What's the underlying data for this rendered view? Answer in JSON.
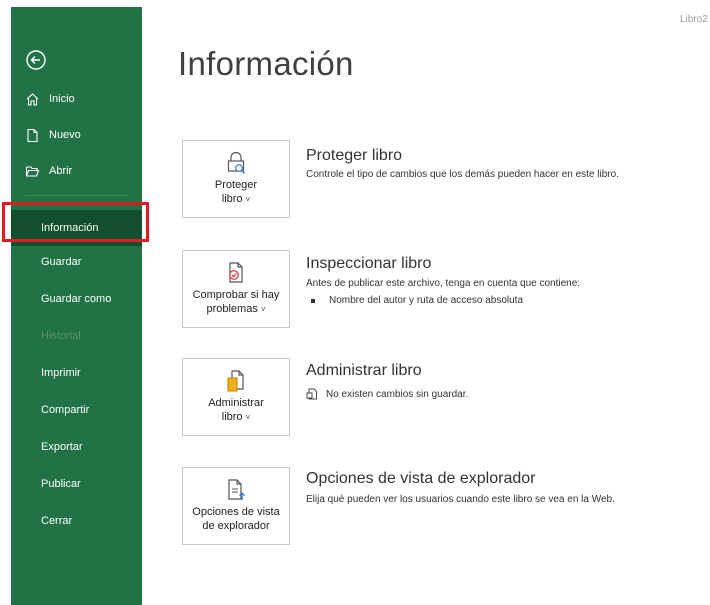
{
  "window": {
    "doc_name": "Libro2"
  },
  "sidebar": {
    "back_icon": "back-arrow-icon",
    "top_items": [
      {
        "label": "Inicio",
        "icon": "home-icon"
      },
      {
        "label": "Nuevo",
        "icon": "new-file-icon"
      },
      {
        "label": "Abrir",
        "icon": "open-folder-icon"
      }
    ],
    "sub_items": [
      {
        "label": "Información",
        "state": "active"
      },
      {
        "label": "Guardar",
        "state": "normal"
      },
      {
        "label": "Guardar como",
        "state": "normal"
      },
      {
        "label": "Historial",
        "state": "disabled"
      },
      {
        "label": "Imprimir",
        "state": "normal"
      },
      {
        "label": "Compartir",
        "state": "normal"
      },
      {
        "label": "Exportar",
        "state": "normal"
      },
      {
        "label": "Publicar",
        "state": "normal"
      },
      {
        "label": "Cerrar",
        "state": "normal"
      }
    ],
    "colors": {
      "background": "#217346",
      "active": "#114f2e",
      "highlight_box": "#e01b24"
    }
  },
  "main": {
    "title": "Información",
    "sections": [
      {
        "button_line1": "Proteger",
        "button_line2": "libro",
        "icon": "lock-icon",
        "heading": "Proteger libro",
        "description": "Controle el tipo de cambios que los demás pueden hacer en este libro."
      },
      {
        "button_line1": "Comprobar si hay",
        "button_line2": "problemas",
        "icon": "check-document-icon",
        "heading": "Inspeccionar libro",
        "description": "Antes de publicar este archivo, tenga en cuenta que contiene:",
        "bullets": [
          "Nombre del autor y ruta de acceso absoluta"
        ]
      },
      {
        "button_line1": "Administrar",
        "button_line2": "libro",
        "icon": "manage-workbook-icon",
        "heading": "Administrar libro",
        "status_icon": "document-icon",
        "status": "No existen cambios sin guardar."
      },
      {
        "button_line1": "Opciones de vista",
        "button_line2": "de explorador",
        "icon": "browser-view-icon",
        "heading": "Opciones de vista de explorador",
        "description": "Elija qué pueden ver los usuarios cuando este libro se vea en la Web."
      }
    ]
  }
}
